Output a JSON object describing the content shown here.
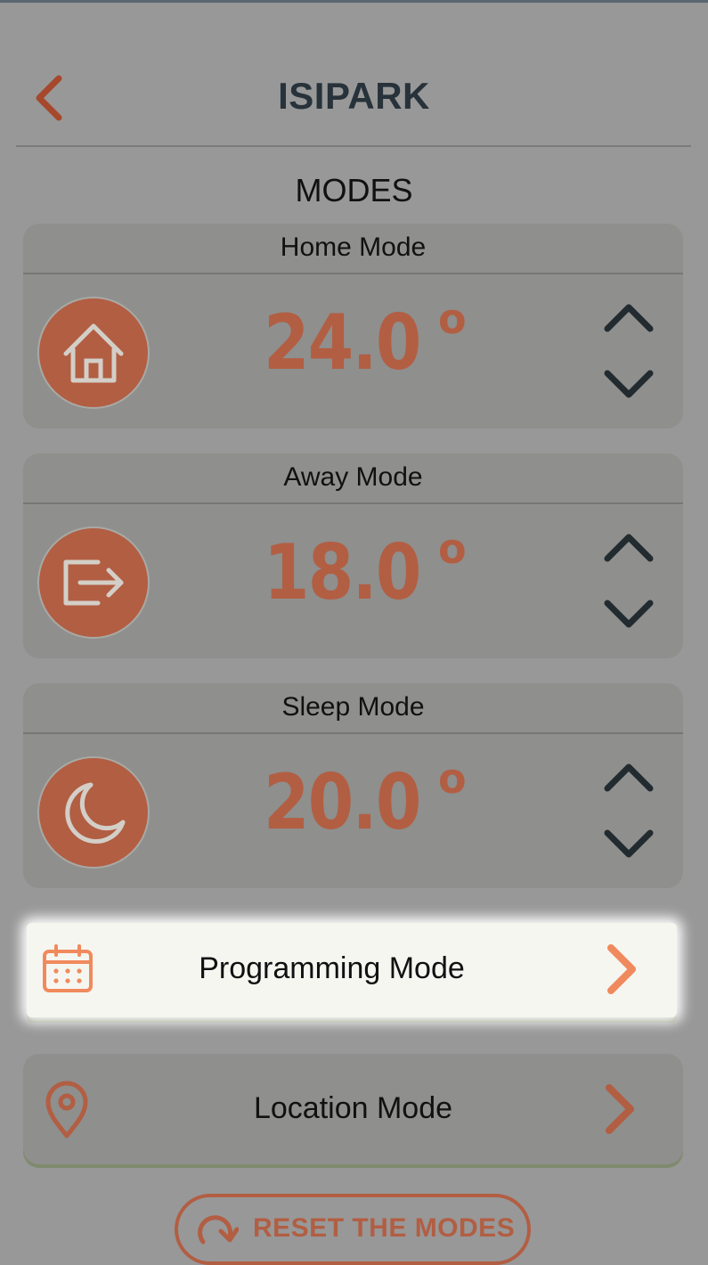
{
  "header": {
    "title": "ISIPARK"
  },
  "section": {
    "title": "MODES"
  },
  "modes": [
    {
      "label": "Home Mode",
      "value": "24.0",
      "degree": "o",
      "icon": "home-icon"
    },
    {
      "label": "Away Mode",
      "value": "18.0",
      "degree": "o",
      "icon": "exit-icon"
    },
    {
      "label": "Sleep Mode",
      "value": "20.0",
      "degree": "o",
      "icon": "moon-icon"
    }
  ],
  "programming": {
    "label": "Programming Mode",
    "icon": "calendar-icon"
  },
  "location": {
    "label": "Location Mode",
    "icon": "location-pin-icon"
  },
  "reset": {
    "label": "RESET THE MODES",
    "icon": "reset-icon"
  },
  "colors": {
    "accent": "#b25e43",
    "accent_bright": "#f08a5d",
    "dark": "#27323a",
    "overlay_bg": "#989898"
  }
}
